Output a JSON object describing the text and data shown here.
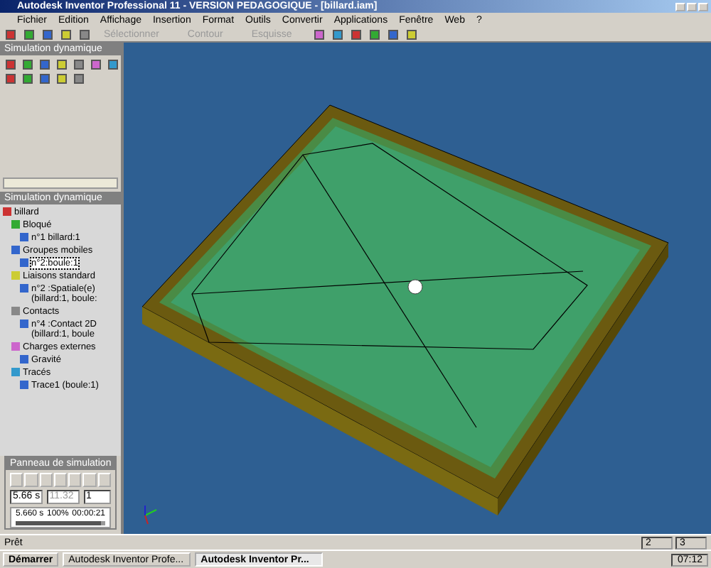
{
  "window": {
    "title": "Autodesk Inventor Professional 11 - VERSION PEDAGOGIQUE - [billard.iam]"
  },
  "menu": [
    "Fichier",
    "Edition",
    "Affichage",
    "Insertion",
    "Format",
    "Outils",
    "Convertir",
    "Applications",
    "Fenêtre",
    "Web",
    "?"
  ],
  "toolbar": {
    "dropdowns": [
      {
        "label": "Sélectionner",
        "disabled": true
      },
      {
        "label": "Contour",
        "disabled": true
      },
      {
        "label": "Esquisse",
        "disabled": true
      }
    ]
  },
  "panel_bar": {
    "title": "Simulation dynamique"
  },
  "browser": {
    "title": "Simulation dynamique",
    "tree": [
      {
        "label": "billard",
        "selected": false,
        "children": [
          {
            "label": "Bloqué",
            "selected": false,
            "children": [
              {
                "label": "n°1 billard:1",
                "selected": false
              }
            ]
          },
          {
            "label": "Groupes mobiles",
            "selected": false,
            "children": [
              {
                "label": "n°2:boule:1",
                "selected": true
              }
            ]
          },
          {
            "label": "Liaisons standard",
            "selected": false,
            "children": [
              {
                "label": "n°2 :Spatiale(e) (billard:1, boule:",
                "selected": false
              }
            ]
          },
          {
            "label": "Contacts",
            "selected": false,
            "children": [
              {
                "label": "n°4 :Contact 2D (billard:1, boule",
                "selected": false
              }
            ]
          },
          {
            "label": "Charges externes",
            "selected": false,
            "children": [
              {
                "label": "Gravité",
                "selected": false
              }
            ]
          },
          {
            "label": "Tracés",
            "selected": false,
            "children": [
              {
                "label": "Trace1 (boule:1)",
                "selected": false
              }
            ]
          }
        ]
      }
    ]
  },
  "simulation_panel": {
    "title": "Panneau de simulation",
    "end_time": "5.66 s",
    "images": "11.32",
    "step": "1",
    "current_time": "5.660 s",
    "percent": "100%",
    "elapsed": "00:00:21",
    "level": 0.96
  },
  "status_bar": {
    "text": "Prêt",
    "fields": [
      "2",
      "3"
    ]
  },
  "taskbar": {
    "start": "Démarrer",
    "tasks": [
      {
        "label": "Autodesk Inventor Profe...",
        "selected": false
      },
      {
        "label": "Autodesk Inventor Pr...",
        "selected": true
      }
    ],
    "clock": "07:12"
  }
}
